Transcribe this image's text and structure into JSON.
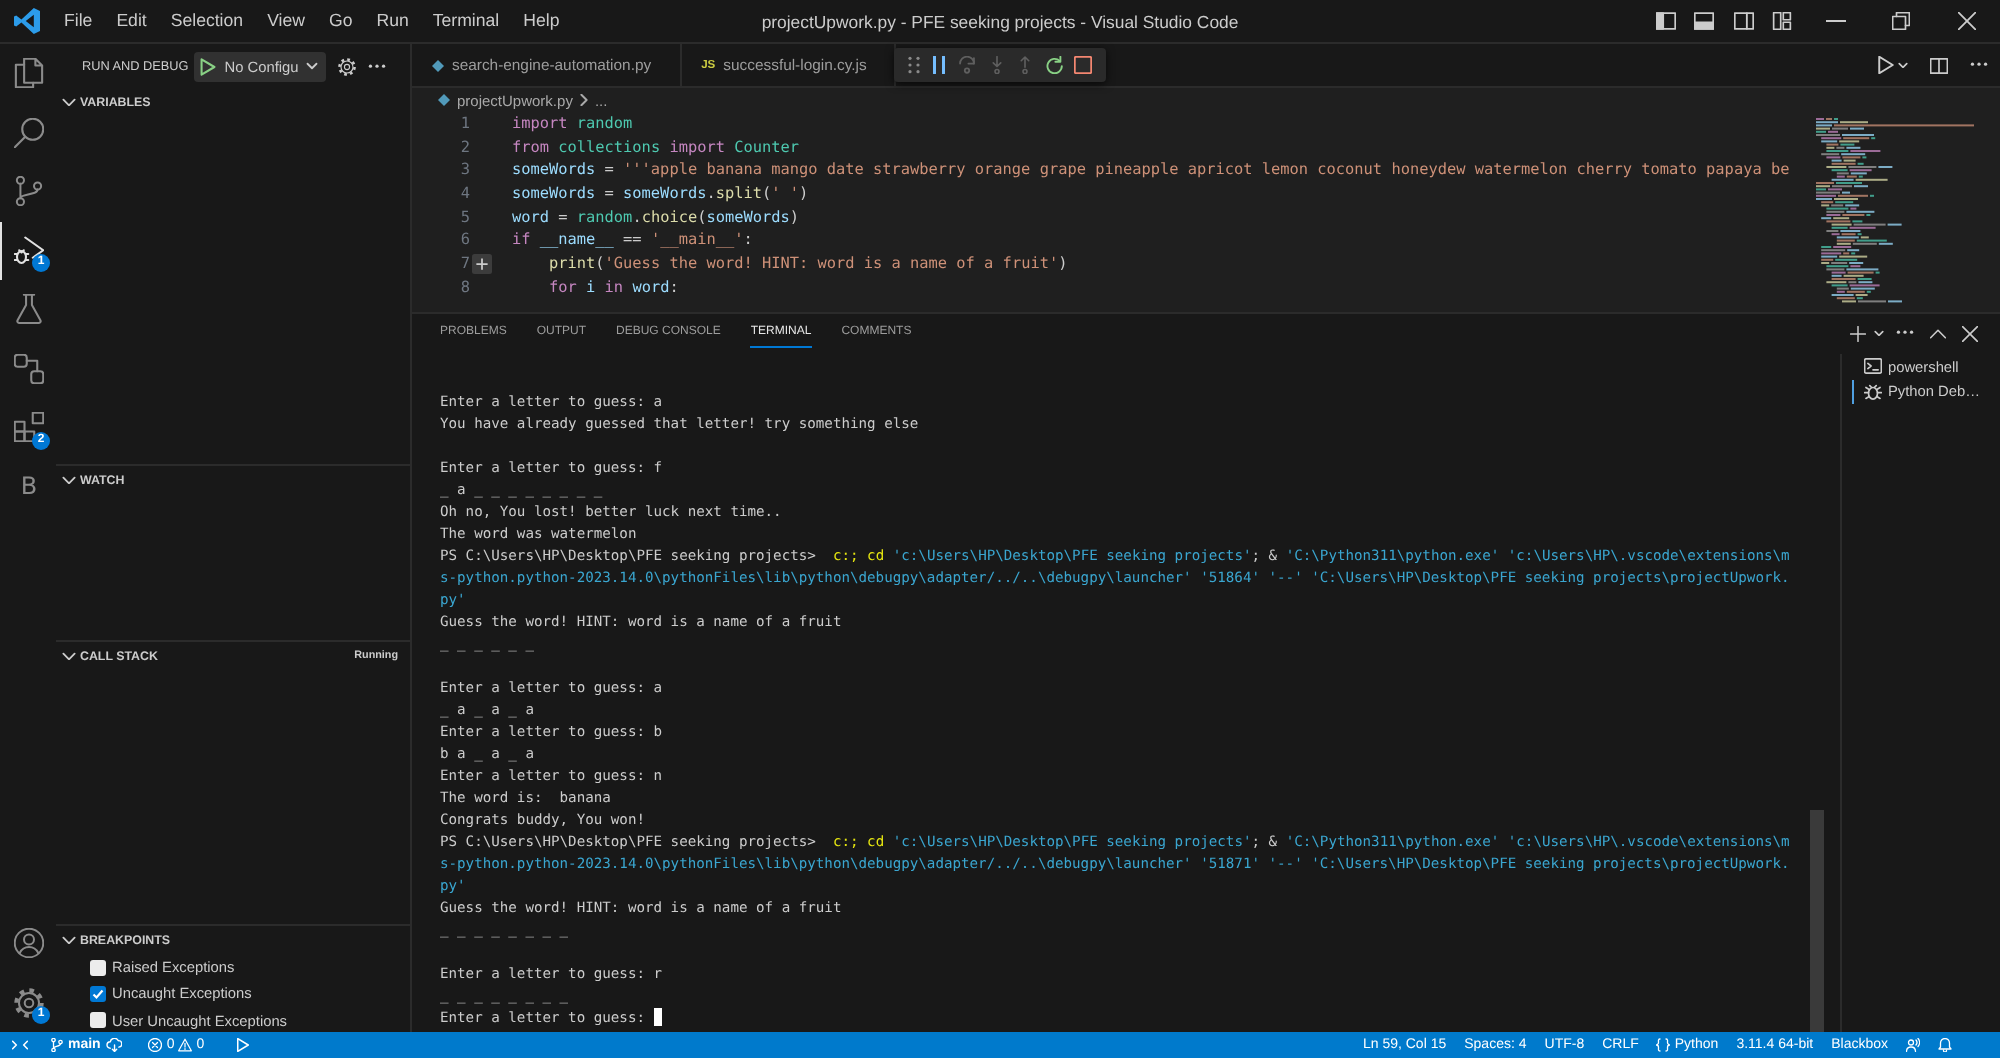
{
  "title_bar": {
    "menu": [
      "File",
      "Edit",
      "Selection",
      "View",
      "Go",
      "Run",
      "Terminal",
      "Help"
    ],
    "title": "projectUpwork.py - PFE seeking projects - Visual Studio Code"
  },
  "activity_bar": {
    "top": [
      {
        "kind": "files",
        "selected": false
      },
      {
        "kind": "search",
        "selected": false
      },
      {
        "kind": "source-control",
        "selected": false
      },
      {
        "kind": "run-debug",
        "selected": true,
        "badge": "1"
      },
      {
        "kind": "testing",
        "selected": false
      },
      {
        "kind": "remote",
        "selected": false
      },
      {
        "kind": "extensions",
        "selected": false,
        "badge": "2"
      },
      {
        "kind": "letter",
        "label": "B",
        "selected": false
      }
    ],
    "bottom": [
      {
        "kind": "account"
      },
      {
        "kind": "settings",
        "badge": "1"
      }
    ]
  },
  "sidebar": {
    "title": "RUN AND DEBUG",
    "configuration": "No Configu",
    "sections": [
      {
        "title": "VARIABLES",
        "expanded": true
      },
      {
        "title": "WATCH",
        "expanded": true
      },
      {
        "title": "CALL STACK",
        "expanded": true,
        "status": "Running"
      },
      {
        "title": "BREAKPOINTS",
        "expanded": true,
        "items": [
          {
            "label": "Raised Exceptions",
            "checked": false
          },
          {
            "label": "Uncaught Exceptions",
            "checked": true
          },
          {
            "label": "User Uncaught Exceptions",
            "checked": false
          }
        ]
      }
    ]
  },
  "editor": {
    "tabs": [
      {
        "label": "search-engine-automation.py",
        "kind": "python",
        "selected": false
      },
      {
        "label": "successful-login.cy.js",
        "kind": "js",
        "icon_text": "JS",
        "selected": false
      }
    ],
    "debug_toolbar": [
      {
        "kind": "pause",
        "disabled": false
      },
      {
        "kind": "step-over",
        "disabled": true
      },
      {
        "kind": "step-into",
        "disabled": true
      },
      {
        "kind": "step-out",
        "disabled": true
      },
      {
        "kind": "restart",
        "disabled": false
      },
      {
        "kind": "stop",
        "disabled": false
      }
    ],
    "breadcrumb": [
      "projectUpwork.py",
      "..."
    ],
    "lines": [
      {
        "number": "1",
        "comment_plus": false,
        "tokens": [
          {
            "text": "import ",
            "kind": "kw"
          },
          {
            "text": "random",
            "kind": "mod"
          }
        ]
      },
      {
        "number": "2",
        "comment_plus": false,
        "tokens": [
          {
            "text": "from ",
            "kind": "kw"
          },
          {
            "text": "collections ",
            "kind": "mod"
          },
          {
            "text": "import ",
            "kind": "kw"
          },
          {
            "text": "Counter",
            "kind": "mod"
          }
        ]
      },
      {
        "number": "3",
        "comment_plus": false,
        "tokens": [
          {
            "text": "someWords",
            "kind": "var"
          },
          {
            "text": " = ",
            "kind": "op"
          },
          {
            "text": "'''apple banana mango date strawberry orange grape pineapple apricot lemon coconut honeydew watermelon cherry tomato papaya be",
            "kind": "str"
          }
        ]
      },
      {
        "number": "4",
        "comment_plus": false,
        "tokens": [
          {
            "text": "someWords",
            "kind": "var"
          },
          {
            "text": " = ",
            "kind": "op"
          },
          {
            "text": "someWords",
            "kind": "var"
          },
          {
            "text": ".",
            "kind": "op"
          },
          {
            "text": "split",
            "kind": "fn"
          },
          {
            "text": "(",
            "kind": "op"
          },
          {
            "text": "' '",
            "kind": "str"
          },
          {
            "text": ")",
            "kind": "op"
          }
        ]
      },
      {
        "number": "5",
        "comment_plus": false,
        "tokens": [
          {
            "text": "word",
            "kind": "var"
          },
          {
            "text": " = ",
            "kind": "op"
          },
          {
            "text": "random",
            "kind": "mod"
          },
          {
            "text": ".",
            "kind": "op"
          },
          {
            "text": "choice",
            "kind": "fn"
          },
          {
            "text": "(",
            "kind": "op"
          },
          {
            "text": "someWords",
            "kind": "var"
          },
          {
            "text": ")",
            "kind": "op"
          }
        ]
      },
      {
        "number": "6",
        "comment_plus": false,
        "tokens": [
          {
            "text": "if ",
            "kind": "kw"
          },
          {
            "text": "__name__",
            "kind": "var"
          },
          {
            "text": " == ",
            "kind": "op"
          },
          {
            "text": "'__main__'",
            "kind": "str"
          },
          {
            "text": ":",
            "kind": "op"
          }
        ]
      },
      {
        "number": "7",
        "comment_plus": true,
        "tokens": [
          {
            "text": "    print",
            "kind": "fn"
          },
          {
            "text": "(",
            "kind": "op"
          },
          {
            "text": "'Guess the word! HINT: word is a name of a fruit'",
            "kind": "str"
          },
          {
            "text": ")",
            "kind": "op"
          }
        ]
      },
      {
        "number": "8",
        "comment_plus": false,
        "tokens": [
          {
            "text": "    for ",
            "kind": "kw"
          },
          {
            "text": "i ",
            "kind": "var"
          },
          {
            "text": "in ",
            "kind": "kw"
          },
          {
            "text": "word",
            "kind": "var"
          },
          {
            "text": ":",
            "kind": "op"
          }
        ]
      }
    ]
  },
  "panel": {
    "tabs": [
      {
        "label": "PROBLEMS",
        "selected": false
      },
      {
        "label": "OUTPUT",
        "selected": false
      },
      {
        "label": "DEBUG CONSOLE",
        "selected": false
      },
      {
        "label": "TERMINAL",
        "selected": true
      },
      {
        "label": "COMMENTS",
        "selected": false
      }
    ],
    "terminal": {
      "cursor": true,
      "blocks": [
        {
          "lines": [
            [
              {
                "text": "Enter a letter to guess: a",
                "kind": "plain"
              }
            ],
            [
              {
                "text": "You have already guessed that letter! try something else",
                "kind": "plain"
              }
            ]
          ]
        },
        {
          "lines": [
            [
              {
                "text": "Enter a letter to guess: f",
                "kind": "plain"
              }
            ],
            [
              {
                "text": "_ a _ _ _ _ _ _ _ _",
                "kind": "plain"
              }
            ],
            [
              {
                "text": "Oh no, You lost! better luck next time..",
                "kind": "plain"
              }
            ],
            [
              {
                "text": "The word was watermelon",
                "kind": "plain"
              }
            ],
            [
              {
                "text": "PS C:\\Users\\HP\\Desktop\\PFE seeking projects>  ",
                "kind": "plain"
              },
              {
                "text": "c:; cd",
                "kind": "command"
              },
              {
                "text": " 'c:\\Users\\HP\\Desktop\\PFE seeking projects'",
                "kind": "string"
              },
              {
                "text": "; & ",
                "kind": "plain"
              },
              {
                "text": "'C:\\Python311\\python.exe' 'c:\\Users\\HP\\.vscode\\extensions\\m",
                "kind": "string"
              }
            ],
            [
              {
                "text": "s-python.python-2023.14.0\\pythonFiles\\lib\\python\\debugpy\\adapter/../..\\debugpy\\launcher' '51864' '--' 'C:\\Users\\HP\\Desktop\\PFE seeking projects\\projectUpwork.",
                "kind": "string"
              }
            ],
            [
              {
                "text": "py'",
                "kind": "string"
              }
            ],
            [
              {
                "text": "Guess the word! HINT: word is a name of a fruit",
                "kind": "plain"
              }
            ],
            [
              {
                "text": "_ _ _ _ _ _",
                "kind": "plain"
              }
            ]
          ]
        },
        {
          "lines": [
            [
              {
                "text": "Enter a letter to guess: a",
                "kind": "plain"
              }
            ],
            [
              {
                "text": "_ a _ a _ a",
                "kind": "plain"
              }
            ],
            [
              {
                "text": "Enter a letter to guess: b",
                "kind": "plain"
              }
            ],
            [
              {
                "text": "b a _ a _ a",
                "kind": "plain"
              }
            ],
            [
              {
                "text": "Enter a letter to guess: n",
                "kind": "plain"
              }
            ],
            [
              {
                "text": "The word is:  banana",
                "kind": "plain"
              }
            ],
            [
              {
                "text": "Congrats buddy, You won!",
                "kind": "plain"
              }
            ],
            [
              {
                "text": "PS C:\\Users\\HP\\Desktop\\PFE seeking projects>  ",
                "kind": "plain"
              },
              {
                "text": "c:; cd",
                "kind": "command"
              },
              {
                "text": " 'c:\\Users\\HP\\Desktop\\PFE seeking projects'",
                "kind": "string"
              },
              {
                "text": "; & ",
                "kind": "plain"
              },
              {
                "text": "'C:\\Python311\\python.exe' 'c:\\Users\\HP\\.vscode\\extensions\\m",
                "kind": "string"
              }
            ],
            [
              {
                "text": "s-python.python-2023.14.0\\pythonFiles\\lib\\python\\debugpy\\adapter/../..\\debugpy\\launcher' '51871' '--' 'C:\\Users\\HP\\Desktop\\PFE seeking projects\\projectUpwork.",
                "kind": "string"
              }
            ],
            [
              {
                "text": "py'",
                "kind": "string"
              }
            ],
            [
              {
                "text": "Guess the word! HINT: word is a name of a fruit",
                "kind": "plain"
              }
            ],
            [
              {
                "text": "_ _ _ _ _ _ _ _",
                "kind": "plain"
              }
            ]
          ]
        },
        {
          "lines": [
            [
              {
                "text": "Enter a letter to guess: r",
                "kind": "plain"
              }
            ],
            [
              {
                "text": "_ _ _ _ _ _ _ _",
                "kind": "plain"
              }
            ],
            [
              {
                "text": "Enter a letter to guess: ",
                "kind": "plain"
              }
            ]
          ]
        }
      ]
    },
    "terminals": [
      {
        "label": "powershell",
        "kind": "shell",
        "selected": false
      },
      {
        "label": "Python Deb…",
        "kind": "debug",
        "selected": true
      }
    ]
  },
  "status_bar": {
    "left": [
      {
        "kind": "remote"
      },
      {
        "kind": "branch",
        "label": "main"
      },
      {
        "kind": "sync"
      },
      {
        "kind": "problems",
        "errors": "0",
        "warnings": "0"
      },
      {
        "kind": "debug"
      }
    ],
    "right": [
      {
        "kind": "text",
        "label": "Ln 59, Col 15"
      },
      {
        "kind": "text",
        "label": "Spaces: 4"
      },
      {
        "kind": "text",
        "label": "UTF-8"
      },
      {
        "kind": "text",
        "label": "CRLF"
      },
      {
        "kind": "language",
        "label": "Python"
      },
      {
        "kind": "text",
        "label": "3.11.4 64-bit"
      },
      {
        "kind": "text",
        "label": "Blackbox"
      },
      {
        "kind": "feedback"
      },
      {
        "kind": "bell"
      }
    ]
  }
}
